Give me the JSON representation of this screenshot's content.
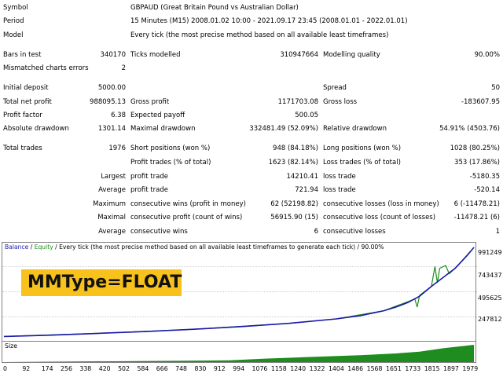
{
  "report": {
    "symbol_label": "Symbol",
    "symbol_value": "GBPAUD (Great Britain Pound vs Australian Dollar)",
    "period_label": "Period",
    "period_value": "15 Minutes (M15) 2008.01.02 10:00 - 2021.09.17 23:45 (2008.01.01 - 2022.01.01)",
    "model_label": "Model",
    "model_value": "Every tick (the most precise method based on all available least timeframes)",
    "bars_label": "Bars in test",
    "bars_value": "340170",
    "ticks_label": "Ticks modelled",
    "ticks_value": "310947664",
    "quality_label": "Modelling quality",
    "quality_value": "90.00%",
    "mismatch_label": "Mismatched charts errors",
    "mismatch_value": "2",
    "deposit_label": "Initial deposit",
    "deposit_value": "5000.00",
    "spread_label": "Spread",
    "spread_value": "50",
    "netprofit_label": "Total net profit",
    "netprofit_value": "988095.13",
    "grossprofit_label": "Gross profit",
    "grossprofit_value": "1171703.08",
    "grossloss_label": "Gross loss",
    "grossloss_value": "-183607.95",
    "pf_label": "Profit factor",
    "pf_value": "6.38",
    "ep_label": "Expected payoff",
    "ep_value": "500.05",
    "absdd_label": "Absolute drawdown",
    "absdd_value": "1301.14",
    "maxdd_label": "Maximal drawdown",
    "maxdd_value": "332481.49 (52.09%)",
    "reldd_label": "Relative drawdown",
    "reldd_value": "54.91% (4503.76)",
    "trades_label": "Total trades",
    "trades_value": "1976",
    "short_label": "Short positions (won %)",
    "short_value": "948 (84.18%)",
    "long_label": "Long positions (won %)",
    "long_value": "1028 (80.25%)",
    "profit_trades_label": "Profit trades (% of total)",
    "profit_trades_value": "1623 (82.14%)",
    "loss_trades_label": "Loss trades (% of total)",
    "loss_trades_value": "353 (17.86%)",
    "largest_label": "Largest",
    "largest_profit_label": "profit trade",
    "largest_profit_value": "14210.41",
    "largest_loss_label": "loss trade",
    "largest_loss_value": "-5180.35",
    "average_label": "Average",
    "average_profit_label": "profit trade",
    "average_profit_value": "721.94",
    "average_loss_label": "loss trade",
    "average_loss_value": "-520.14",
    "maximum_label": "Maximum",
    "max_cons_wins_label": "consecutive wins (profit in money)",
    "max_cons_wins_value": "62 (52198.82)",
    "max_cons_losses_label": "consecutive losses (loss in money)",
    "max_cons_losses_value": "6 (-11478.21)",
    "maximal_label": "Maximal",
    "maximal_profit_label": "consecutive profit (count of wins)",
    "maximal_profit_value": "56915.90 (15)",
    "maximal_loss_label": "consecutive loss (count of losses)",
    "maximal_loss_value": "-11478.21 (6)",
    "average2_label": "Average",
    "avg_cons_wins_label": "consecutive wins",
    "avg_cons_wins_value": "6",
    "avg_cons_losses_label": "consecutive losses",
    "avg_cons_losses_value": "1"
  },
  "chart": {
    "legend_balance": "Balance",
    "legend_sep1": " / ",
    "legend_equity": "Equity",
    "legend_rest": " / Every tick (the most precise method based on all available least timeframes to generate each tick) / 90.00%",
    "overlay_label": "MMType=FLOAT",
    "size_label": "Size",
    "y_ticks": [
      "991249",
      "743437",
      "495625",
      "247812"
    ],
    "x_ticks": [
      "0",
      "92",
      "174",
      "256",
      "338",
      "420",
      "502",
      "584",
      "666",
      "748",
      "830",
      "912",
      "994",
      "1076",
      "1158",
      "1240",
      "1322",
      "1404",
      "1486",
      "1568",
      "1651",
      "1733",
      "1815",
      "1897",
      "1979"
    ],
    "colors": {
      "balance": "#1a1aa8",
      "equity": "#1e8c1e",
      "overlay": "#f7c21b"
    }
  },
  "chart_data": {
    "type": "line",
    "title": "",
    "xlabel": "",
    "ylabel": "",
    "ylim": [
      0,
      991249
    ],
    "xlim": [
      0,
      1979
    ],
    "series": [
      {
        "name": "Balance",
        "x": [
          0,
          200,
          400,
          600,
          800,
          1000,
          1200,
          1400,
          1500,
          1600,
          1650,
          1700,
          1750,
          1800,
          1850,
          1900,
          1950,
          1979
        ],
        "y": [
          5000,
          20000,
          40000,
          60000,
          85000,
          115000,
          150000,
          200000,
          235000,
          290000,
          330000,
          380000,
          450000,
          560000,
          660000,
          760000,
          900000,
          991249
        ]
      },
      {
        "name": "Equity",
        "x": [
          0,
          400,
          800,
          1200,
          1400,
          1600,
          1730,
          1740,
          1750,
          1800,
          1815,
          1825,
          1835,
          1860,
          1875,
          1900,
          1979
        ],
        "y": [
          5000,
          40000,
          85000,
          150000,
          200000,
          290000,
          420000,
          330000,
          460000,
          560000,
          780000,
          600000,
          760000,
          790000,
          700000,
          760000,
          991249
        ]
      }
    ],
    "size_series": {
      "name": "Size",
      "x": [
        0,
        950,
        1100,
        1300,
        1500,
        1650,
        1750,
        1850,
        1979
      ],
      "y": [
        0,
        0.1,
        0.2,
        0.3,
        0.4,
        0.5,
        0.6,
        0.8,
        1.0
      ]
    },
    "grid": true,
    "legend": "top-left"
  }
}
